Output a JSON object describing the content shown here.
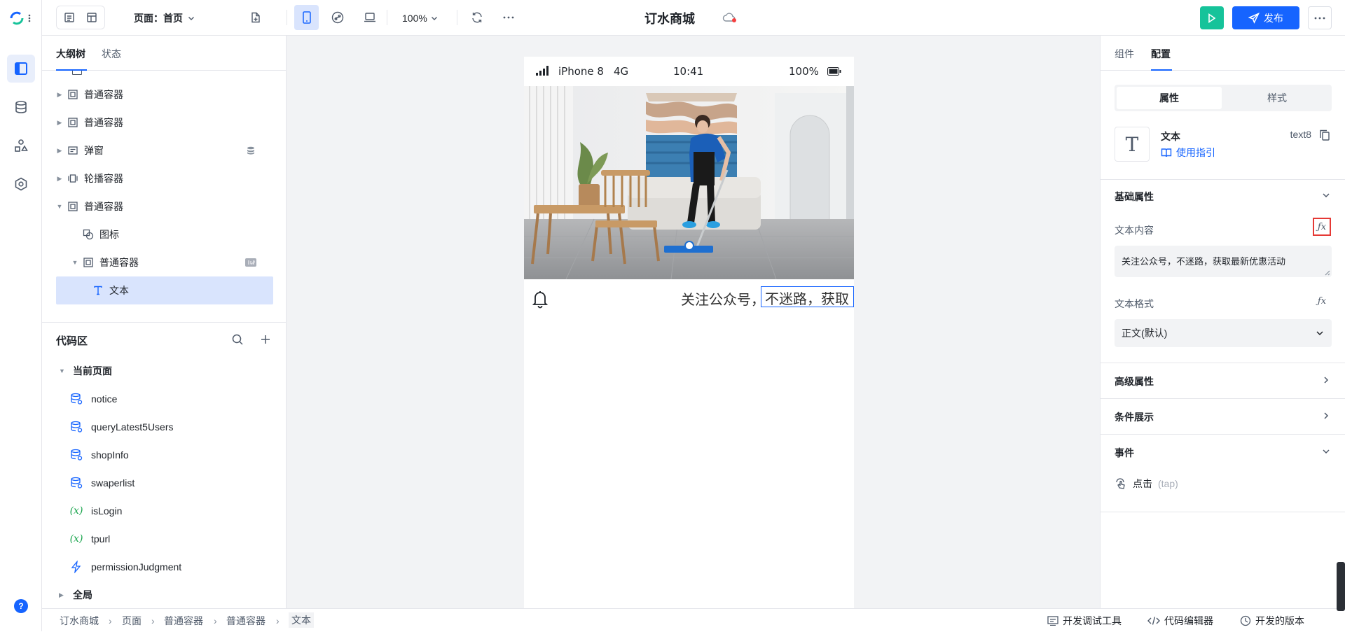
{
  "topbar": {
    "page_label": "页面：首页",
    "zoom": "100%",
    "app_title": "订水商城",
    "publish_label": "发布"
  },
  "left_panel": {
    "tabs": [
      "大纲树",
      "状态"
    ],
    "tree": [
      {
        "label": "普通容器",
        "icon": "container-icon"
      },
      {
        "label": "普通容器",
        "icon": "container-icon"
      },
      {
        "label": "弹窗",
        "icon": "dialog-icon"
      },
      {
        "label": "轮播容器",
        "icon": "carousel-icon"
      },
      {
        "label": "普通容器",
        "icon": "container-icon"
      },
      {
        "label": "图标",
        "icon": "icon-component-icon"
      },
      {
        "label": "普通容器",
        "icon": "container-icon"
      },
      {
        "label": "文本",
        "icon": "text-icon"
      }
    ],
    "code_title": "代码区",
    "code_groups": {
      "current": "当前页面",
      "global": "全局"
    },
    "code_items": [
      {
        "label": "notice",
        "type": "datasource-icon"
      },
      {
        "label": "queryLatest5Users",
        "type": "datasource-icon"
      },
      {
        "label": "shopInfo",
        "type": "datasource-icon"
      },
      {
        "label": "swaperlist",
        "type": "datasource-icon"
      },
      {
        "label": "isLogin",
        "type": "variable-icon"
      },
      {
        "label": "tpurl",
        "type": "variable-icon"
      },
      {
        "label": "permissionJudgment",
        "type": "function-icon"
      }
    ]
  },
  "phone": {
    "carrier": "iPhone 8",
    "network": "4G",
    "time": "10:41",
    "battery": "100%",
    "notice_prefix": "关注公众号，",
    "notice_selected": "不迷路，获取"
  },
  "right_panel": {
    "tabs": [
      "组件",
      "配置"
    ],
    "seg": [
      "属性",
      "样式"
    ],
    "component_name": "文本",
    "component_id": "text8",
    "guide_link": "使用指引",
    "basic_title": "基础属性",
    "text_content_label": "文本内容",
    "text_content_value": "关注公众号，不迷路，获取最新优惠活动",
    "text_format_label": "文本格式",
    "text_format_value": "正文(默认)",
    "advanced_title": "高级属性",
    "condition_title": "条件展示",
    "events_title": "事件",
    "event_tap": "点击",
    "event_tap_code": "(tap)"
  },
  "bottombar": {
    "breadcrumb": [
      "订水商城",
      "页面",
      "普通容器",
      "普通容器",
      "文本"
    ],
    "devtools": "开发调试工具",
    "code_editor": "代码编辑器",
    "dev_version": "开发的版本"
  },
  "colors": {
    "accent": "#1664ff",
    "run": "#16c39a",
    "highlight": "#e53935"
  }
}
